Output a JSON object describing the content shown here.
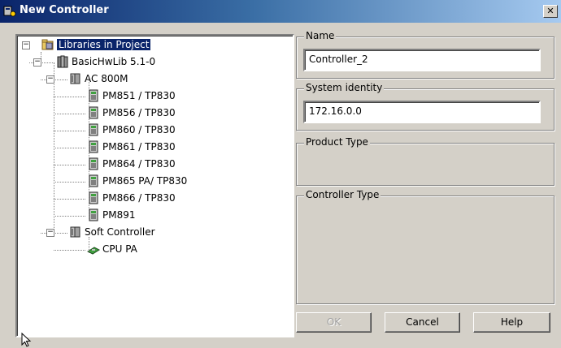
{
  "window": {
    "title": "New Controller",
    "close_glyph": "✕"
  },
  "tree": [
    {
      "label": "Libraries in Project",
      "level": 0,
      "expander": "−",
      "icon": "library-folder-icon",
      "selected": true
    },
    {
      "label": "BasicHwLib 5.1-0",
      "level": 1,
      "expander": "−",
      "icon": "hardware-library-icon"
    },
    {
      "label": "AC 800M",
      "level": 2,
      "expander": "−",
      "icon": "controller-rack-icon"
    },
    {
      "label": "PM851 / TP830",
      "level": 3,
      "icon": "processor-module-icon"
    },
    {
      "label": "PM856 / TP830",
      "level": 3,
      "icon": "processor-module-icon"
    },
    {
      "label": "PM860 / TP830",
      "level": 3,
      "icon": "processor-module-icon"
    },
    {
      "label": "PM861 / TP830",
      "level": 3,
      "icon": "processor-module-icon"
    },
    {
      "label": "PM864 / TP830",
      "level": 3,
      "icon": "processor-module-icon"
    },
    {
      "label": "PM865 PA/ TP830",
      "level": 3,
      "icon": "processor-module-icon"
    },
    {
      "label": "PM866 / TP830",
      "level": 3,
      "icon": "processor-module-icon"
    },
    {
      "label": "PM891",
      "level": 3,
      "icon": "processor-module-icon"
    },
    {
      "label": "Soft Controller",
      "level": 2,
      "expander": "−",
      "icon": "controller-rack-icon"
    },
    {
      "label": "CPU PA",
      "level": 3,
      "icon": "cpu-board-icon"
    }
  ],
  "name_group": {
    "label": "Name",
    "value": "Controller_2"
  },
  "identity_group": {
    "label": "System identity",
    "value": "172.16.0.0"
  },
  "product_group": {
    "label": "Product Type"
  },
  "controller_group": {
    "label": "Controller Type"
  },
  "buttons": {
    "ok": "OK",
    "cancel": "Cancel",
    "help": "Help"
  },
  "colors": {
    "title_start": "#0a246a",
    "title_end": "#a6caf0",
    "selection": "#0a246a",
    "dialog_bg": "#d4d0c8"
  }
}
